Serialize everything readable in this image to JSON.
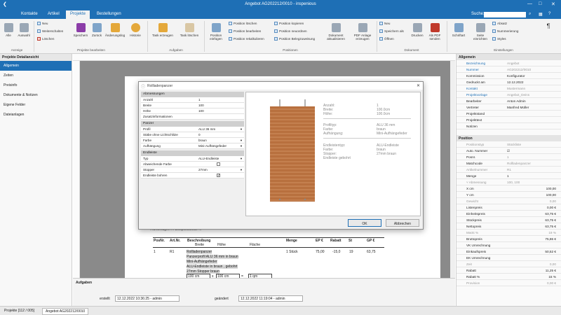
{
  "titlebar": {
    "title": "Angebot AG202212/0010 - inspenious",
    "min": "—",
    "max": "□",
    "close": "✕",
    "back": "❮"
  },
  "menu": {
    "tabs": [
      "Kontakte",
      "Artikel",
      "Projekte",
      "Bestellungen"
    ],
    "active": 2,
    "search_label": "Suche:"
  },
  "ribbon": {
    "groups": [
      "Anzeige",
      "Projekte bearbeiten",
      "Aufgaben",
      "Positionen",
      "Dokument",
      "Einstellungen"
    ],
    "anzeige": [
      "Alle",
      "Auswahl"
    ],
    "projekte_small": [
      "Neu",
      "Weiterschalten",
      "Löschen"
    ],
    "projekte_big": [
      "Speichern",
      "Zurück",
      "Änderungslog",
      "Historie"
    ],
    "aufgaben": [
      "Task erzeugen",
      "Task löschen"
    ],
    "positionen_big": [
      "Position einfügen"
    ],
    "positionen_small": [
      "Position löschen",
      "Position bearbeiten",
      "Position rekalkulieren",
      "Position kopieren",
      "Position neuordnen",
      "Position Belegzuweisung"
    ],
    "positionen_big2": [
      "Dokument aktualisieren",
      "PDF Anlage erzeugen"
    ],
    "dokument_small": [
      "Neu",
      "Speichern als",
      "Öffnen"
    ],
    "dokument_big": [
      "Drucken",
      "Als PDF senden"
    ],
    "einstellungen_big": [
      "Schriftart",
      "Seite einrichten"
    ],
    "einstellungen_small": [
      "Absatz",
      "Nummerierung",
      "Styles"
    ]
  },
  "left": {
    "header": "Projekte Detailansicht",
    "items": [
      "Allgemein",
      "Zeiten",
      "Preisinfo",
      "Dokumente & Notizen",
      "Eigene Felder",
      "Dateianlagen"
    ],
    "selected": 0
  },
  "dialog": {
    "title": "Rollladenpanzer",
    "sections": {
      "abm": "Abmessungen",
      "panzer": "Panzer",
      "endleiste": "Endleiste"
    },
    "abm_rows": [
      [
        "Anzahl",
        "1"
      ],
      [
        "Breite",
        "100"
      ],
      [
        "Höhe",
        "100"
      ],
      [
        "Zusatzinformationen",
        ""
      ]
    ],
    "panzer_rows": [
      [
        "Profil",
        "ALU 36 mm"
      ],
      [
        "Stäbe ohne Lichtschlitze",
        "0"
      ],
      [
        "Farbe",
        "braun"
      ],
      [
        "Aufhängung",
        "Mini-Aufhängefeder"
      ]
    ],
    "endleiste_rows": [
      [
        "Typ",
        "ALU-Endleiste"
      ],
      [
        "Abweichende Farbe",
        ""
      ],
      [
        "Stopper",
        "27mm"
      ],
      [
        "Endleiste bohren",
        "✓"
      ]
    ],
    "preview": {
      "labels1": [
        "Anzahl:",
        "Breite:",
        "Höhe:"
      ],
      "values1": [
        "1",
        "100.0cm",
        "100.0cm"
      ],
      "labels2": [
        "Profiltyp:",
        "Farbe:",
        "Aufhängung:"
      ],
      "values2": [
        "ALU 36 mm",
        "braun",
        "Mini-Aufhängefeder"
      ],
      "labels3": [
        "Endleistentyp:",
        "Farbe:",
        "Stopper:",
        "Endleiste gebohrt"
      ],
      "values3": [
        "ALU-Endleiste",
        "braun",
        "27mm braun",
        ""
      ],
      "panzer_color": "#b8703e"
    },
    "ok": "OK",
    "cancel": "Abbrechen"
  },
  "document": {
    "subtitle": "...Unterlagen ... beispielsweise ...",
    "headers": [
      "PosNr.",
      "Art.Nr.",
      "Beschreibung",
      "Menge",
      "EP €",
      "Rabatt",
      "St",
      "GP €"
    ],
    "subheaders": [
      "Breite",
      "Höhe",
      "Fläche"
    ],
    "row": {
      "pos": "1",
      "art": "R1",
      "menge": "1 Stück",
      "ep": "75,00",
      "rabatt": "-15,0",
      "st": "19",
      "gp": "63,75"
    },
    "desc": [
      "Rollladenpanzer",
      "Panzerprofil ALU 36 mm in braun",
      "Mini-Aufhängefeder",
      "ALU-Endleiste in braun , gebohrt",
      "27mm Stopper braun"
    ],
    "dims": {
      "b": "100 cm",
      "x": "x",
      "h": "100 cm",
      "eq": "=",
      "area": "1 qm"
    }
  },
  "aufgaben": {
    "title": "Aufgaben",
    "erstellt_label": "erstellt",
    "erstellt": "12.12.2022 10:36:25 - admin",
    "geaendert_label": "geändert",
    "geaendert": "12.12.2022 11:19:04 - admin"
  },
  "status": {
    "tabs": [
      "Projekte [112 / 005]",
      "Angebot AG202212/0010"
    ],
    "active": 1
  },
  "right": {
    "allgemein_title": "Allgemein",
    "allgemein": [
      [
        "Bezeichnung",
        "Angebot",
        "link",
        "gray"
      ],
      [
        "Nummer",
        "AG202212/0010",
        "link",
        "gray"
      ],
      [
        "Kommission",
        "Konfigurator",
        "",
        ""
      ],
      [
        "Gedruckt am",
        "12.12.2022",
        "",
        ""
      ],
      [
        "Kontakt",
        "Mustermann",
        "link",
        "gray"
      ],
      [
        "Projektvorlage",
        "Angebot_Deins",
        "link",
        "gray"
      ],
      [
        "Bearbeiter",
        "Anton Admin",
        "",
        ""
      ],
      [
        "Vertreter",
        "Manfred Müller",
        "",
        ""
      ],
      [
        "Projektstand",
        "",
        "",
        ""
      ],
      [
        "Projekttext",
        "",
        "",
        ""
      ],
      [
        "Notizen",
        "",
        "",
        ""
      ]
    ],
    "position_title": "Position",
    "position": [
      [
        "Positionstyp",
        "Stückliste",
        "gray",
        "gray"
      ],
      [
        "Auto. Nummer",
        "☑",
        "",
        ""
      ],
      [
        "Posnr.",
        "1",
        "",
        "gray"
      ],
      [
        "Matchcode",
        "Rollladenpanzer",
        "",
        "gray"
      ],
      [
        "Artikelnummer",
        "R1",
        "gray",
        "gray"
      ],
      [
        "Menge",
        "1",
        "",
        ""
      ],
      [
        "˅ Abmessung",
        "100, 100",
        "gray",
        "gray"
      ],
      [
        "X cm",
        "100,00",
        "",
        "r"
      ],
      [
        "Y cm",
        "100,00",
        "",
        "r"
      ],
      [
        "Gewicht",
        "0,00",
        "gray",
        "rgray"
      ],
      [
        "Listenpreis",
        "0,00 €",
        "",
        "r"
      ],
      [
        "Einheitspreis",
        "63,75 €",
        "",
        "r"
      ],
      [
        "Stückpreis",
        "63,75 €",
        "",
        "r"
      ],
      [
        "Nettopreis",
        "63,75 €",
        "",
        "r"
      ],
      [
        "MwSt %",
        "19 %",
        "gray",
        "rgray"
      ],
      [
        "Bruttopreis",
        "75,86 €",
        "",
        "r"
      ],
      [
        "VK Umrechnung",
        "",
        "",
        ""
      ],
      [
        "Einkaufspreis",
        "50,52 €",
        "",
        "r"
      ],
      [
        "EK Umrechnung",
        "",
        "",
        ""
      ],
      [
        "Zeit",
        "0,00",
        "gray",
        "rgray"
      ],
      [
        "Rabatt",
        "11,25 €",
        "",
        "r"
      ],
      [
        "Rabatt %",
        "15 %",
        "",
        "r"
      ],
      [
        "Provision",
        "0,00 €",
        "gray",
        "rgray"
      ]
    ]
  }
}
